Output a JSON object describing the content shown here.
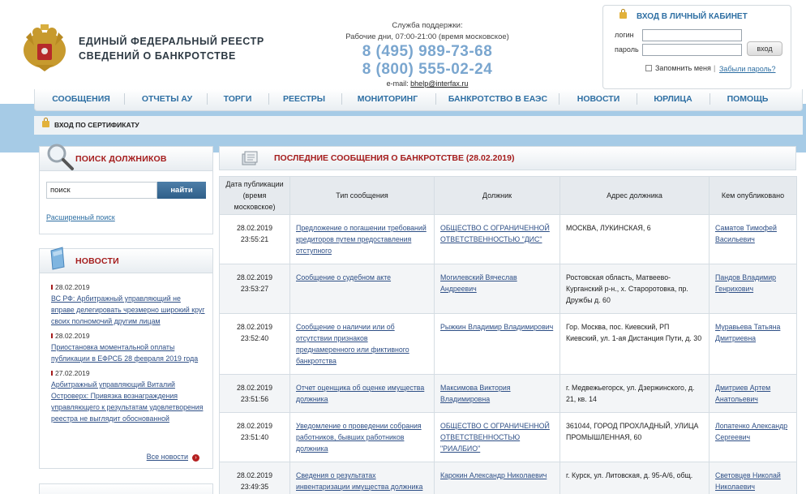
{
  "header": {
    "site_title_line1": "ЕДИНЫЙ ФЕДЕРАЛЬНЫЙ РЕЕСТР",
    "site_title_line2": "СВЕДЕНИЙ О БАНКРОТСТВЕ",
    "support_label": "Служба поддержки:",
    "support_hours": "Рабочие дни, 07:00-21:00 (время московское)",
    "phone1": "8 (495) 989-73-68",
    "phone2": "8 (800) 555-02-24",
    "email_label": "e-mail:",
    "email": "bhelp@interfax.ru"
  },
  "login": {
    "title": "ВХОД В ЛИЧНЫЙ КАБИНЕТ",
    "login_label": "логин",
    "password_label": "пароль",
    "login_value": "",
    "password_value": "",
    "enter_button": "вход",
    "remember_label": "Запомнить меня",
    "separator": "|",
    "forgot_link": "Забыли пароль?"
  },
  "nav": {
    "items": [
      "СООБЩЕНИЯ",
      "ОТЧЕТЫ АУ",
      "ТОРГИ",
      "РЕЕСТРЫ",
      "МОНИТОРИНГ",
      "БАНКРОТСТВО В ЕАЭС",
      "НОВОСТИ",
      "ЮРЛИЦА",
      "ПОМОЩЬ"
    ]
  },
  "cert_login": "ВХОД ПО СЕРТИФИКАТУ",
  "search_panel": {
    "title": "ПОИСК ДОЛЖНИКОВ",
    "input_value": "поиск",
    "button": "найти",
    "advanced_link": "Расширенный поиск"
  },
  "news_panel": {
    "title": "НОВОСТИ",
    "items": [
      {
        "date": "28.02.2019",
        "text": "ВС РФ: Арбитражный управляющий не вправе делегировать чрезмерно широкий круг своих полномочий другим лицам"
      },
      {
        "date": "28.02.2019",
        "text": "Приостановка моментальной оплаты публикации в ЕФРСБ 28 февраля 2019 года"
      },
      {
        "date": "27.02.2019",
        "text": "Арбитражный управляющий Виталий Островерх: Привязка вознаграждения управляющего к результатам удовлетворения реестра не выглядит обоснованной"
      }
    ],
    "all_news": "Все новости",
    "arrow": "›"
  },
  "messages": {
    "title": "ПОСЛЕДНИЕ СООБЩЕНИЯ О БАНКРОТСТВЕ (28.02.2019)",
    "columns": [
      "Дата публикации (время московское)",
      "Тип сообщения",
      "Должник",
      "Адрес должника",
      "Кем опубликовано"
    ],
    "rows": [
      {
        "date": "28.02.2019",
        "time": "23:55:21",
        "type": "Предложение о погашении требований кредиторов путем предоставления отступного",
        "debtor": "ОБЩЕСТВО С ОГРАНИЧЕННОЙ ОТВЕТСТВЕННОСТЬЮ \"ДИС\"",
        "address": "МОСКВА, ЛУКИНСКАЯ, 6",
        "publisher": "Саматов Тимофей Васильевич"
      },
      {
        "date": "28.02.2019",
        "time": "23:53:27",
        "type": "Сообщение о судебном акте",
        "debtor": "Могилевский Вячеслав Андреевич",
        "address": "Ростовская область, Матвеево-Курганский р-н., х. Староротовка, пр. Дружбы д. 60",
        "publisher": "Пандов Владимир Генрихович"
      },
      {
        "date": "28.02.2019",
        "time": "23:52:40",
        "type": "Сообщение о наличии или об отсутствии признаков преднамеренного или фиктивного банкротства",
        "debtor": "Рыжкин Владимир Владимирович",
        "address": "Гор. Москва, пос. Киевский, РП Киевский, ул. 1-ая Дистанция Пути, д. 30",
        "publisher": "Муравьева Татьяна Дмитриевна"
      },
      {
        "date": "28.02.2019",
        "time": "23:51:56",
        "type": "Отчет оценщика об оценке имущества должника",
        "debtor": "Максимова Виктория Владимировна",
        "address": "г. Медвежьегорск, ул. Дзержинского, д. 21, кв. 14",
        "publisher": "Дмитриев Артем Анатольевич"
      },
      {
        "date": "28.02.2019",
        "time": "23:51:40",
        "type": "Уведомление о проведении собрания работников, бывших работников должника",
        "debtor": "ОБЩЕСТВО С ОГРАНИЧЕННОЙ ОТВЕТСТВЕННОСТЬЮ \"РИАЛБИО\"",
        "address": "361044, ГОРОД ПРОХЛАДНЫЙ, УЛИЦА ПРОМЫШЛЕННАЯ, 60",
        "publisher": "Лопатенко Александр Сергеевич"
      },
      {
        "date": "28.02.2019",
        "time": "23:49:35",
        "type": "Сведения о результатах инвентаризации имущества должника",
        "debtor": "Карокин Александр Николаевич",
        "address": "г. Курск, ул. Литовская, д. 95-А/6, общ.",
        "publisher": "Световцев Николай Николаевич"
      }
    ]
  },
  "colors": {
    "accent_blue": "#2e6fa3",
    "accent_red": "#a51d1d",
    "phone_blue": "#7aa6cf",
    "band_blue": "#a6cbe6"
  }
}
